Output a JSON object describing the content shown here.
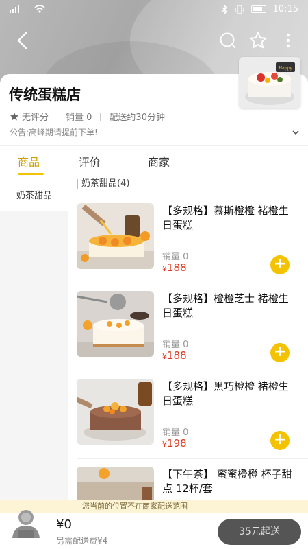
{
  "status_bar": {
    "time": "10:15"
  },
  "store": {
    "name": "传统蛋糕店",
    "rating": "无评分",
    "sales": "销量 0",
    "delivery_time": "配送约30分钟",
    "notice": "公告:高峰期请提前下单!"
  },
  "tabs": [
    {
      "label": "商品",
      "active": true
    },
    {
      "label": "评价",
      "active": false
    },
    {
      "label": "商家",
      "active": false
    }
  ],
  "sidebar": {
    "items": [
      {
        "label": "奶茶甜品"
      }
    ]
  },
  "category": {
    "title": "奶茶甜品(4)"
  },
  "products": [
    {
      "name": "【多规格】慕斯橙橙 褚橙生日蛋糕",
      "sales": "销量 0",
      "currency": "¥",
      "price": "188"
    },
    {
      "name": "【多规格】橙橙芝士 褚橙生日蛋糕",
      "sales": "销量 0",
      "currency": "¥",
      "price": "188"
    },
    {
      "name": "【多规格】黑巧橙橙 褚橙生日蛋糕",
      "sales": "销量 0",
      "currency": "¥",
      "price": "198"
    },
    {
      "name": "【下午茶】 蜜蜜橙橙 杯子甜点 12杯/套",
      "sales": "",
      "currency": "",
      "price": ""
    }
  ],
  "bottom": {
    "location_notice": "您当前的位置不在商家配送范围",
    "total": "¥0",
    "delivery_fee": "另需配送费¥4",
    "checkout": "35元起送"
  },
  "colors": {
    "accent": "#f3c200",
    "price": "#e03b24"
  },
  "icons": [
    "back-icon",
    "chat-icon",
    "star-icon",
    "more-icon",
    "star-rating-icon",
    "chevron-down-icon",
    "plus-icon",
    "cart-icon"
  ]
}
